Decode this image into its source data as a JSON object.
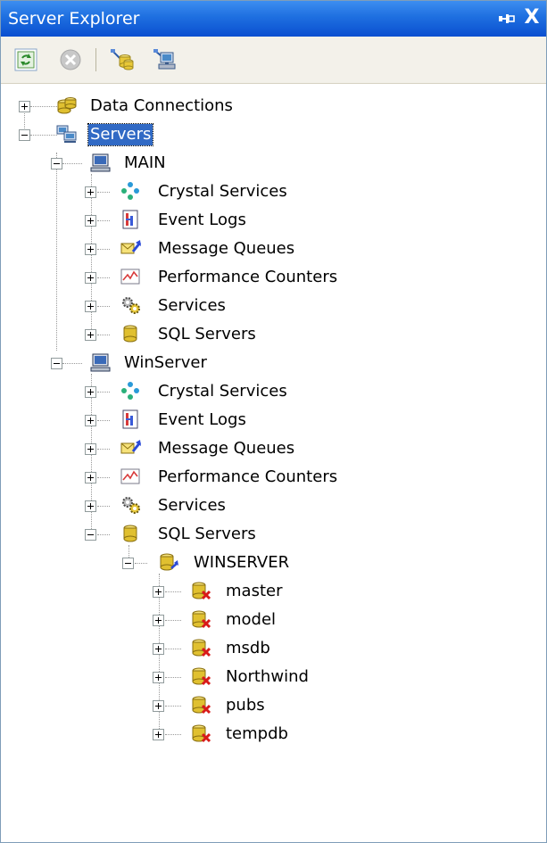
{
  "window": {
    "title": "Server Explorer",
    "pin_icon": "pushpin-icon",
    "close_symbol": "X",
    "colors": {
      "title_bar": "#0a4fd0",
      "selection": "#316ac5"
    }
  },
  "toolbar": {
    "buttons": [
      {
        "icon": "refresh-icon"
      },
      {
        "icon": "stop-icon"
      },
      {
        "icon": "connect-to-database-icon"
      },
      {
        "icon": "connect-to-server-icon"
      }
    ]
  },
  "tree": {
    "data_connections": "Data Connections",
    "servers": "Servers",
    "main": {
      "name": "MAIN",
      "children": [
        "Crystal Services",
        "Event Logs",
        "Message Queues",
        "Performance Counters",
        "Services",
        "SQL Servers"
      ]
    },
    "winserver": {
      "name": "WinServer",
      "children": [
        "Crystal Services",
        "Event Logs",
        "Message Queues",
        "Performance Counters",
        "Services",
        "SQL Servers"
      ],
      "sql_instance": "WINSERVER",
      "databases": [
        "master",
        "model",
        "msdb",
        "Northwind",
        "pubs",
        "tempdb"
      ]
    }
  }
}
